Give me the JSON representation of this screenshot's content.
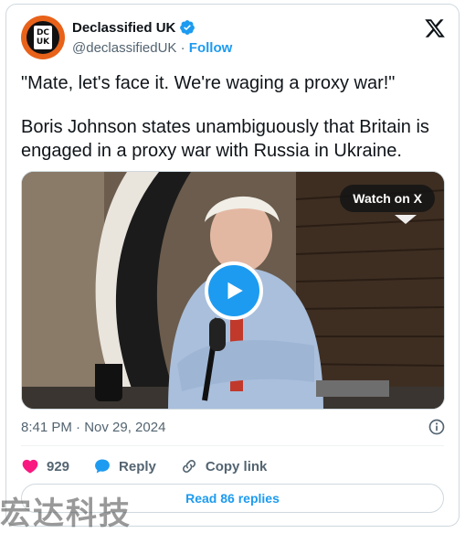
{
  "author": {
    "display_name": "Declassified UK",
    "handle": "@declassifiedUK",
    "separator": " · ",
    "follow_label": "Follow",
    "avatar_logo": [
      "DC",
      "UK"
    ],
    "verified": true
  },
  "tweet": {
    "quote": "\"Mate, let's face it. We're waging a proxy war!\"",
    "body": "Boris Johnson states unambiguously that Britain is engaged in a proxy war with Russia in Ukraine.",
    "timestamp": "8:41 PM · Nov 29, 2024"
  },
  "media": {
    "type": "video",
    "watch_label": "Watch on X"
  },
  "actions": {
    "like_count": "929",
    "reply_label": "Reply",
    "copy_link_label": "Copy link"
  },
  "replies_button": "Read 86 replies",
  "watermark": "宏达科技",
  "colors": {
    "accent": "#1d9bf0",
    "like": "#f91880",
    "text": "#0f1419",
    "muted": "#536471",
    "border": "#cfd9de",
    "avatar_bg": "#e8621a"
  }
}
